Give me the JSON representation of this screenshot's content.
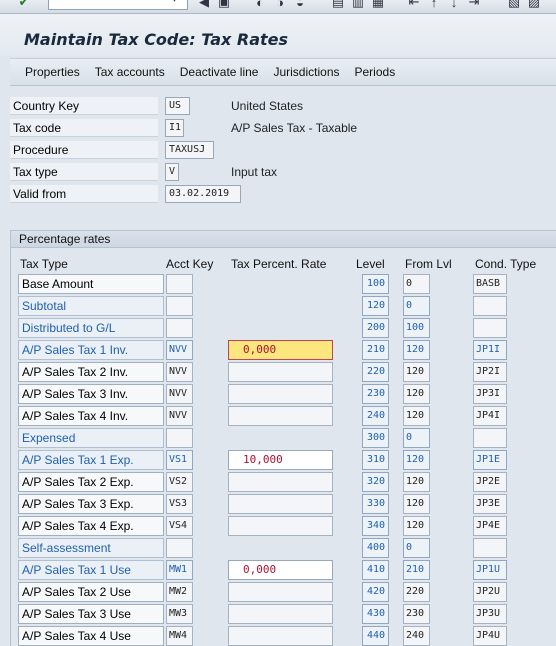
{
  "title": "Maintain Tax Code: Tax Rates",
  "menu": [
    "Properties",
    "Tax accounts",
    "Deactivate line",
    "Jurisdictions",
    "Periods"
  ],
  "header": {
    "country_key": {
      "label": "Country Key",
      "value": "US",
      "desc": "United States"
    },
    "tax_code": {
      "label": "Tax code",
      "value": "I1",
      "desc": "A/P Sales Tax - Taxable"
    },
    "procedure": {
      "label": "Procedure",
      "value": "TAXUSJ"
    },
    "tax_type": {
      "label": "Tax type",
      "value": "V",
      "desc": "Input tax"
    },
    "valid_from": {
      "label": "Valid from",
      "value": "03.02.2019"
    }
  },
  "rates": {
    "group_title": "Percentage rates",
    "columns": [
      "Tax Type",
      "Acct Key",
      "Tax Percent. Rate",
      "Level",
      "From Lvl",
      "Cond. Type"
    ],
    "rows": [
      {
        "type": "Base Amount",
        "acct": "",
        "rate": "",
        "level": "100",
        "from": "0",
        "cond": "BASB"
      },
      {
        "type": "Subtotal",
        "acct": "",
        "rate": "",
        "level": "120",
        "from": "0",
        "cond": ""
      },
      {
        "type": "Distributed to G/L",
        "acct": "",
        "rate": "",
        "level": "200",
        "from": "100",
        "cond": ""
      },
      {
        "type": "A/P Sales Tax 1 Inv.",
        "acct": "NVV",
        "rate": "0,000",
        "level": "210",
        "from": "120",
        "cond": "JP1I"
      },
      {
        "type": "A/P Sales Tax 2 Inv.",
        "acct": "NVV",
        "rate": "",
        "level": "220",
        "from": "120",
        "cond": "JP2I"
      },
      {
        "type": "A/P Sales Tax 3 Inv.",
        "acct": "NVV",
        "rate": "",
        "level": "230",
        "from": "120",
        "cond": "JP3I"
      },
      {
        "type": "A/P Sales Tax 4 Inv.",
        "acct": "NVV",
        "rate": "",
        "level": "240",
        "from": "120",
        "cond": "JP4I"
      },
      {
        "type": "Expensed",
        "acct": "",
        "rate": "",
        "level": "300",
        "from": "0",
        "cond": ""
      },
      {
        "type": "A/P Sales Tax 1 Exp.",
        "acct": "VS1",
        "rate": "10,000",
        "level": "310",
        "from": "120",
        "cond": "JP1E"
      },
      {
        "type": "A/P Sales Tax 2 Exp.",
        "acct": "VS2",
        "rate": "",
        "level": "320",
        "from": "120",
        "cond": "JP2E"
      },
      {
        "type": "A/P Sales Tax 3 Exp.",
        "acct": "VS3",
        "rate": "",
        "level": "330",
        "from": "120",
        "cond": "JP3E"
      },
      {
        "type": "A/P Sales Tax 4 Exp.",
        "acct": "VS4",
        "rate": "",
        "level": "340",
        "from": "120",
        "cond": "JP4E"
      },
      {
        "type": "Self-assessment",
        "acct": "",
        "rate": "",
        "level": "400",
        "from": "0",
        "cond": ""
      },
      {
        "type": "A/P Sales Tax 1 Use",
        "acct": "MW1",
        "rate": "0,000",
        "level": "410",
        "from": "210",
        "cond": "JP1U"
      },
      {
        "type": "A/P Sales Tax 2 Use",
        "acct": "MW2",
        "rate": "",
        "level": "420",
        "from": "220",
        "cond": "JP2U"
      },
      {
        "type": "A/P Sales Tax 3 Use",
        "acct": "MW3",
        "rate": "",
        "level": "430",
        "from": "230",
        "cond": "JP3U"
      },
      {
        "type": "A/P Sales Tax 4 Use",
        "acct": "MW4",
        "rate": "",
        "level": "440",
        "from": "240",
        "cond": "JP4U"
      }
    ]
  }
}
